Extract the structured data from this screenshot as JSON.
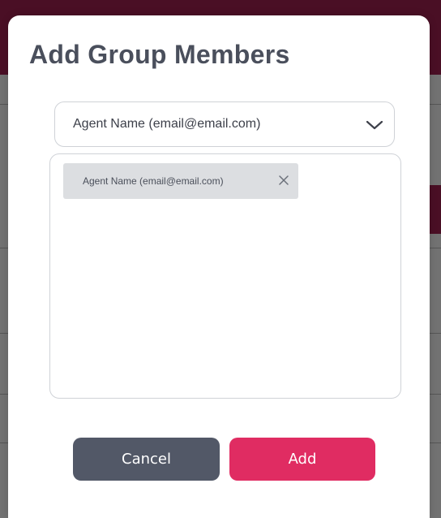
{
  "modal": {
    "title": "Add Group Members"
  },
  "agent_select": {
    "selected_value": "Agent Name (email@email.com)",
    "icon": "chevron-down-icon"
  },
  "members": [
    {
      "label": "Agent Name (email@email.com)",
      "remove_icon": "close-icon"
    }
  ],
  "actions": {
    "cancel_label": "Cancel",
    "add_label": "Add"
  },
  "colors": {
    "primary_accent": "#e02c62",
    "secondary_button": "#525867",
    "backdrop_bar": "#4a0f25"
  }
}
